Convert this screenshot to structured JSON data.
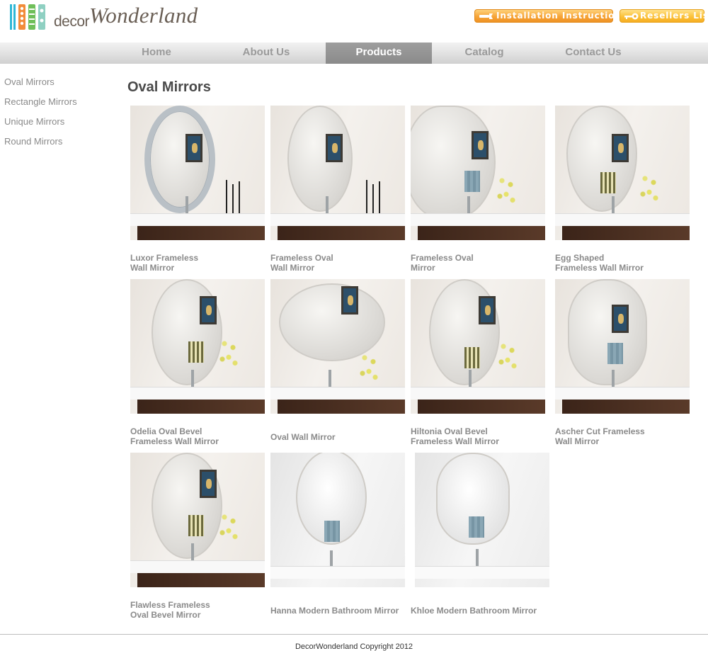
{
  "brand": {
    "logo_prefix": "decor",
    "logo_name": "Wonderland"
  },
  "header_buttons": {
    "installation": "Installation Instructions",
    "resellers": "Resellers List"
  },
  "nav": [
    {
      "label": "Home",
      "active": false
    },
    {
      "label": "About Us",
      "active": false
    },
    {
      "label": "Products",
      "active": true
    },
    {
      "label": "Catalog",
      "active": false
    },
    {
      "label": "Contact Us",
      "active": false
    }
  ],
  "sidebar": [
    {
      "label": "Oval Mirrors"
    },
    {
      "label": "Rectangle Mirrors"
    },
    {
      "label": "Unique Mirrors"
    },
    {
      "label": "Round Mirrors"
    }
  ],
  "page_title": "Oval Mirrors",
  "products": [
    {
      "lines": [
        "Luxor Frameless",
        "Wall Mirror"
      ]
    },
    {
      "lines": [
        "Frameless Oval",
        "Wall Mirror"
      ]
    },
    {
      "lines": [
        "Frameless Oval",
        "Mirror"
      ]
    },
    {
      "lines": [
        "Egg Shaped",
        "Frameless Wall  Mirror"
      ]
    },
    {
      "lines": [
        "Odelia Oval Bevel",
        "Frameless Wall Mirror"
      ]
    },
    {
      "lines": [
        "Oval Wall Mirror"
      ]
    },
    {
      "lines": [
        "Hiltonia Oval Bevel",
        "Frameless Wall Mirror"
      ]
    },
    {
      "lines": [
        "Ascher Cut Frameless",
        "Wall Mirror"
      ]
    },
    {
      "lines": [
        "Flawless Frameless",
        "Oval Bevel Mirror"
      ]
    },
    {
      "lines": [
        "Hanna Modern Bathroom Mirror"
      ]
    },
    {
      "lines": [
        "Khloe Modern Bathroom Mirror"
      ]
    }
  ],
  "footer": {
    "copyright": "DecorWonderland Copyright 2012"
  },
  "colors": {
    "button_orange": "#f6a437",
    "button_yellow": "#fbc23a",
    "nav_active": "#8f8f8f",
    "title_text": "#4a4a4a"
  }
}
